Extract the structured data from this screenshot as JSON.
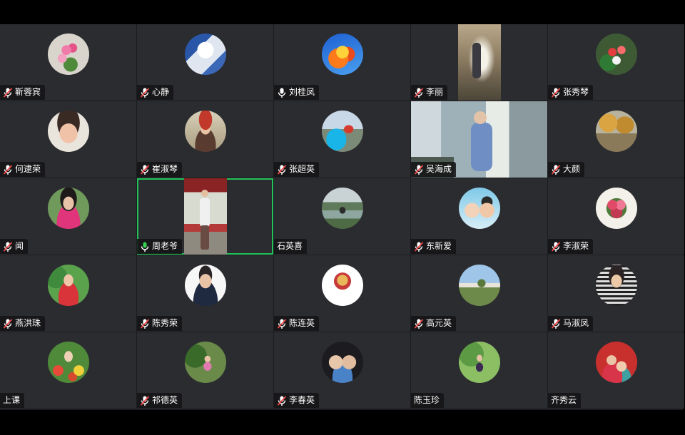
{
  "colors": {
    "background": "#000000",
    "tile": "#2b2c30",
    "active_border": "#22c35a",
    "speaking_mic": "#35d04e"
  },
  "participants": [
    {
      "name": "靳蓉宾",
      "mic": "muted",
      "media": "avatar",
      "image": "pink-flower-bouquet"
    },
    {
      "name": "心静",
      "mic": "muted",
      "media": "avatar",
      "image": "blue-white-room"
    },
    {
      "name": "刘桂凤",
      "mic": "unmuted",
      "media": "avatar",
      "image": "golden-phoenix"
    },
    {
      "name": "李丽",
      "mic": "muted",
      "media": "video",
      "image": "person-exercising-indoors"
    },
    {
      "name": "张秀琴",
      "mic": "muted",
      "media": "avatar",
      "image": "red-white-flowers"
    },
    {
      "name": "何逮荣",
      "mic": "muted",
      "media": "avatar",
      "image": "woman-portrait"
    },
    {
      "name": "崔淑琴",
      "mic": "muted",
      "media": "avatar",
      "image": "woman-red-hat"
    },
    {
      "name": "张超英",
      "mic": "muted",
      "media": "avatar",
      "image": "woman-blue-car"
    },
    {
      "name": "吴海成",
      "mic": "muted",
      "media": "video",
      "image": "man-stretching-room"
    },
    {
      "name": "大颜",
      "mic": "muted",
      "media": "avatar",
      "image": "autumn-trees"
    },
    {
      "name": "闻",
      "mic": "muted",
      "media": "avatar",
      "image": "woman-red-scarf"
    },
    {
      "name": "周老爷",
      "mic": "speaking",
      "media": "video",
      "image": "man-pavilion",
      "active": true
    },
    {
      "name": "石英喜",
      "mic": "none",
      "media": "avatar",
      "image": "man-lakeside"
    },
    {
      "name": "东新爱",
      "mic": "muted",
      "media": "avatar",
      "image": "two-kids"
    },
    {
      "name": "李淑荣",
      "mic": "muted",
      "media": "avatar",
      "image": "heart-flowers"
    },
    {
      "name": "燕洪珠",
      "mic": "muted",
      "media": "avatar",
      "image": "woman-garden"
    },
    {
      "name": "陈秀荣",
      "mic": "muted",
      "media": "avatar",
      "image": "man-suit"
    },
    {
      "name": "陈连英",
      "mic": "muted",
      "media": "avatar",
      "image": "white-sticker"
    },
    {
      "name": "高元英",
      "mic": "muted",
      "media": "avatar",
      "image": "man-great-wall"
    },
    {
      "name": "马淑凤",
      "mic": "muted",
      "media": "avatar",
      "image": "woman-microphone"
    },
    {
      "name": "上课",
      "mic": "none",
      "media": "avatar",
      "image": "woman-flower-field"
    },
    {
      "name": "祁德英",
      "mic": "muted",
      "media": "avatar",
      "image": "woman-trees"
    },
    {
      "name": "李春英",
      "mic": "muted",
      "media": "avatar",
      "image": "two-babies"
    },
    {
      "name": "陈玉珍",
      "mic": "none",
      "media": "avatar",
      "image": "woman-greenery"
    },
    {
      "name": "齐秀云",
      "mic": "none",
      "media": "avatar",
      "image": "woman-child"
    }
  ]
}
